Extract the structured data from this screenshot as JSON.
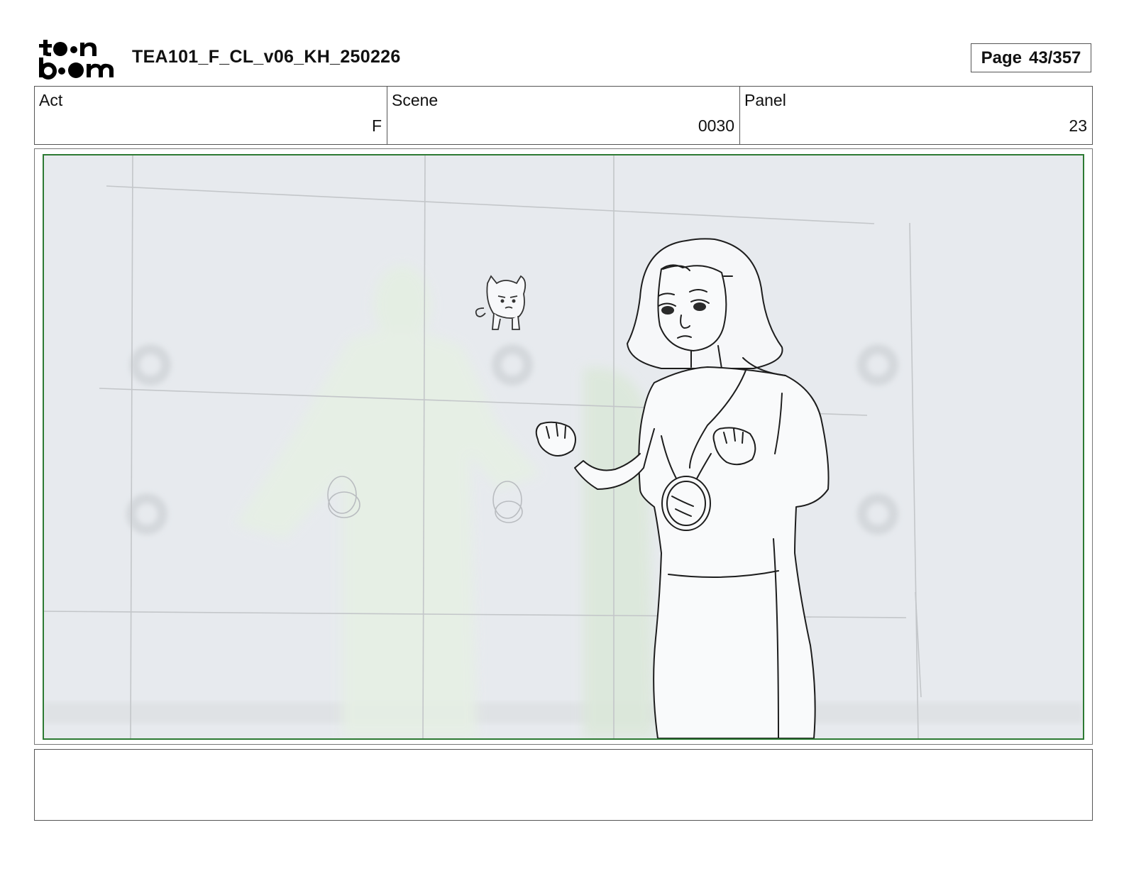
{
  "header": {
    "logo_text": "toon boom",
    "document_title": "TEA101_F_CL_v06_KH_250226",
    "page_label": "Page",
    "page_number": "43/357"
  },
  "info": {
    "act": {
      "label": "Act",
      "value": "F"
    },
    "scene": {
      "label": "Scene",
      "value": "0030"
    },
    "panel": {
      "label": "Panel",
      "value": "23"
    }
  },
  "panel_image": {
    "frame_color": "#2d7a33",
    "content": "storyboard-drawing"
  },
  "notes": {
    "text": ""
  }
}
